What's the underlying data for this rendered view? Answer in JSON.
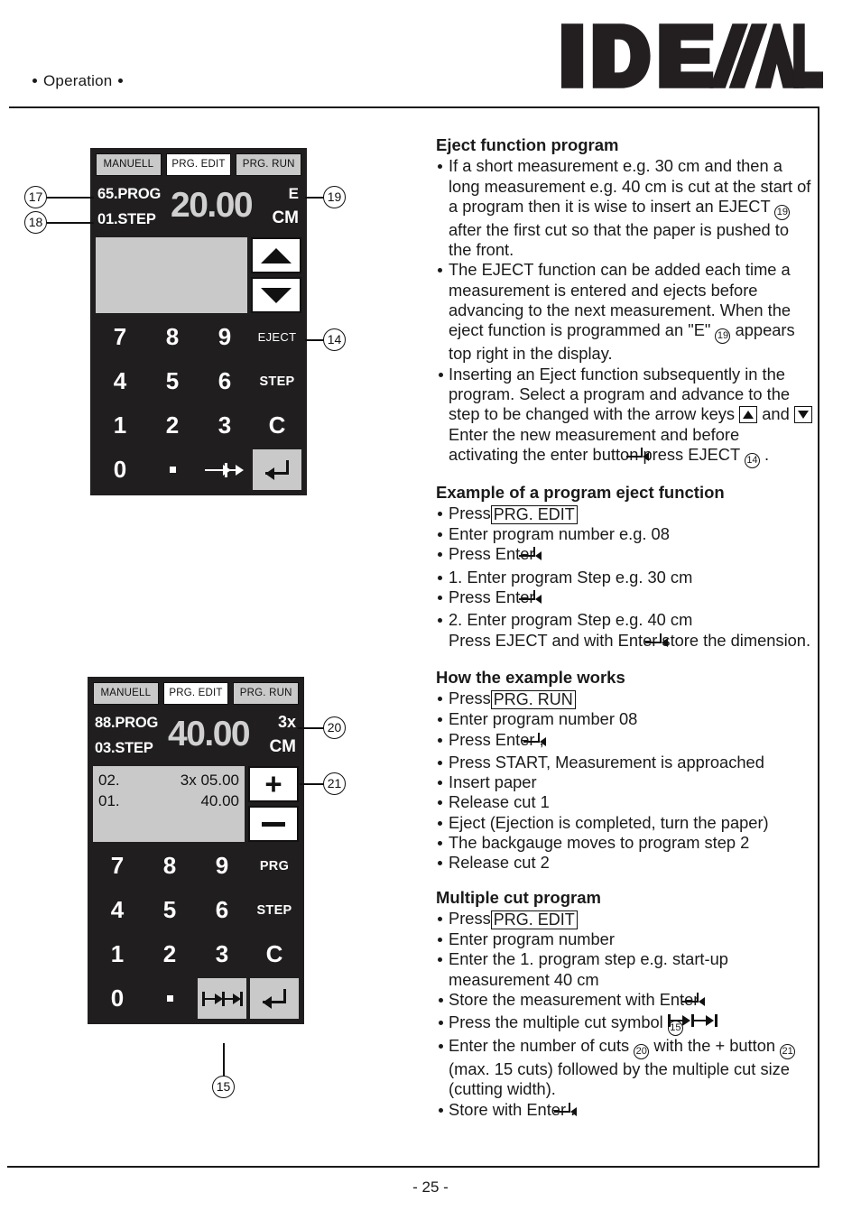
{
  "header": {
    "section": "Operation",
    "brand": "IDEAL"
  },
  "footer": {
    "page_number": "- 25 -"
  },
  "device1": {
    "modes": [
      {
        "label": "MANUELL",
        "active": false
      },
      {
        "label": "PRG. EDIT",
        "active": true
      },
      {
        "label": "PRG. RUN",
        "active": false
      }
    ],
    "readout": {
      "program": "65.PROG",
      "step": "01.STEP",
      "value": "20.00",
      "flag": "E",
      "unit": "CM"
    },
    "list_rows": [],
    "side_buttons": [
      {
        "icon": "triangle-up-icon"
      },
      {
        "icon": "triangle-down-icon"
      }
    ],
    "keys": [
      "7",
      "8",
      "9",
      "EJECT",
      "4",
      "5",
      "6",
      "STEP",
      "1",
      "2",
      "3",
      "C",
      "0",
      ".",
      "multi-cut-icon",
      "enter-icon"
    ],
    "callouts": [
      {
        "num": "17",
        "target": "program-number"
      },
      {
        "num": "18",
        "target": "step-number"
      },
      {
        "num": "19",
        "target": "eject-flag"
      },
      {
        "num": "14",
        "target": "eject-key"
      }
    ]
  },
  "device2": {
    "modes": [
      {
        "label": "MANUELL",
        "active": false
      },
      {
        "label": "PRG. EDIT",
        "active": true
      },
      {
        "label": "PRG. RUN",
        "active": false
      }
    ],
    "readout": {
      "program": "88.PROG",
      "step": "03.STEP",
      "value": "40.00",
      "flag": "3x",
      "unit": "CM"
    },
    "list_rows": [
      {
        "index": "02.",
        "value": "3x 05.00"
      },
      {
        "index": "01.",
        "value": "40.00"
      }
    ],
    "side_buttons": [
      {
        "icon": "plus-icon"
      },
      {
        "icon": "minus-icon"
      }
    ],
    "keys": [
      "7",
      "8",
      "9",
      "PRG",
      "4",
      "5",
      "6",
      "STEP",
      "1",
      "2",
      "3",
      "C",
      "0",
      ".",
      "multi-cut-icon",
      "enter-icon"
    ],
    "callouts": [
      {
        "num": "20",
        "target": "multi-cut-count"
      },
      {
        "num": "21",
        "target": "plus-button"
      },
      {
        "num": "15",
        "target": "multi-cut-key"
      }
    ]
  },
  "content": {
    "s1": {
      "title": "Eject function program",
      "b1a": "If a short measurement e.g. 30 cm and then a long measurement e.g. 40 cm is cut at the start of a program then it is wise to insert an EJECT",
      "b1b": "after the first cut so that the paper is pushed to the front.",
      "b2a": "The EJECT function can be added each time a measurement is entered and ejects before advancing to the next measurement. When the eject function is programmed an \"E\"",
      "b2b": "appears top right in the display.",
      "b3a": "Inserting an Eject function subsequently in the program. Select a program and advance to the step to be changed with the arrow keys",
      "b3b": "and",
      "b3c": "Enter the new measurement and before activating the enter button",
      "b3d": "press EJECT",
      "b3e": "."
    },
    "s2": {
      "title": "Example of a program eject function",
      "l1": "Press",
      "l1_btn": "PRG. EDIT",
      "l2": "Enter program number e.g. 08",
      "l3": "Press Enter",
      "l4": "1. Enter program Step e.g. 30 cm",
      "l5": "Press Enter",
      "l6": "2. Enter program Step e.g. 40 cm",
      "l6b": "Press EJECT and with Enter",
      "l6c": "store the dimension."
    },
    "s3": {
      "title": "How the example works",
      "l1": "Press",
      "l1_btn": "PRG. RUN",
      "l2": "Enter program number 08",
      "l3": "Press Enter",
      "l3b": ",",
      "l4": "Press START, Measurement is approached",
      "l5": "Insert paper",
      "l6": "Release cut 1",
      "l7": "Eject (Ejection is completed, turn the paper)",
      "l8": "The backgauge moves to program step 2",
      "l9": "Release cut 2"
    },
    "s4": {
      "title": "Multiple cut program",
      "l1": "Press",
      "l1_btn": "PRG. EDIT",
      "l2": "Enter program number",
      "l3": "Enter the 1. program step e.g. start-up measurement 40 cm",
      "l4": "Store the measurement with Enter",
      "l5": "Press the multiple cut symbol",
      "l5_ref": "15",
      "l6a": "Enter the number of cuts",
      "l6_ref1": "20",
      "l6b": "with the + button",
      "l6_ref2": "21",
      "l6c": "(max. 15 cuts) followed by the multiple cut size (cutting width).",
      "l7": "Store with Enter",
      "l7b": "."
    }
  },
  "refs": {
    "r14": "14",
    "r15": "15",
    "r19": "19",
    "r20": "20",
    "r21": "21"
  }
}
